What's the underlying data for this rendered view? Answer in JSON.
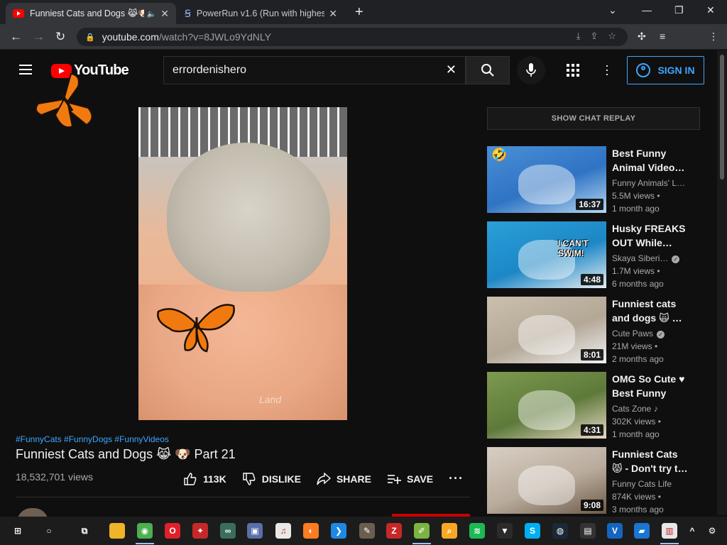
{
  "browser": {
    "tabs": [
      {
        "title": "Funniest Cats and Dogs 😹🐶 P",
        "active": true
      },
      {
        "title": "PowerRun v1.6 (Run with highest",
        "active": false
      }
    ],
    "url_host": "youtube.com",
    "url_path": "/watch?v=8JWLo9YdNLY"
  },
  "youtube": {
    "logo_text": "YouTube",
    "search_value": "errordenishero",
    "sign_in_label": "SIGN IN"
  },
  "video": {
    "watermark": "Land",
    "hashtags": "#FunnyCats #FunnyDogs #FunnyVideos",
    "title": "Funniest Cats and Dogs 😹 🐶 Part 21",
    "views": "18,532,701 views",
    "like_count": "113K",
    "dislike_label": "DISLIKE",
    "share_label": "SHARE",
    "save_label": "SAVE"
  },
  "sidebar": {
    "chat_replay_label": "SHOW CHAT REPLAY",
    "recommendations": [
      {
        "title": "Best Funny Animal Video…",
        "channel": "Funny Animals' L…",
        "verified": false,
        "views": "5.5M views •",
        "age": "1 month ago",
        "duration": "16:37",
        "thumb_text": "",
        "emoji": "🤣",
        "colors": [
          "#4a8fd6",
          "#2f73c4",
          "#b6d6ef"
        ]
      },
      {
        "title": "Husky FREAKS OUT While…",
        "channel": "Skaya Siberi…",
        "verified": true,
        "views": "1.7M views •",
        "age": "6 months ago",
        "duration": "4:48",
        "thumb_text": "I CAN'T SWIM!",
        "emoji": "",
        "colors": [
          "#2a9fd8",
          "#1d87c6",
          "#e9eef2"
        ]
      },
      {
        "title": "Funniest cats and dogs 🙀 …",
        "channel": "Cute Paws",
        "verified": true,
        "views": "21M views •",
        "age": "2 months ago",
        "duration": "8:01",
        "thumb_text": "",
        "emoji": "",
        "colors": [
          "#cbbfae",
          "#b3a796",
          "#f1f1f1"
        ]
      },
      {
        "title": "OMG So Cute ♥ Best Funny Ca…",
        "channel": "Cats Zone ♪",
        "verified": false,
        "views": "302K views •",
        "age": "1 month ago",
        "duration": "4:31",
        "thumb_text": "",
        "emoji": "",
        "colors": [
          "#7c9a4f",
          "#5e7a3a",
          "#e7d8c6"
        ]
      },
      {
        "title": "Funniest Cats 😾 - Don't try t…",
        "channel": "Funny Cats Life",
        "verified": false,
        "views": "874K views •",
        "age": "3 months ago",
        "duration": "9:08",
        "thumb_text": "",
        "emoji": "",
        "colors": [
          "#d8cfc4",
          "#b9ab9c",
          "#6d5a48"
        ]
      }
    ]
  },
  "taskbar": {
    "apps": [
      "windows-start",
      "search",
      "task-view",
      "file-explorer",
      "chrome",
      "opera",
      "unknown-red",
      "network-app",
      "image-app",
      "itunes",
      "firefox",
      "vscode",
      "gimp",
      "filezilla",
      "notepad-plus",
      "search-tool",
      "spotify",
      "wolf-app",
      "skype",
      "steam",
      "film-app",
      "vc-app",
      "app-blue",
      "doc-app",
      "tray-chevron",
      "settings"
    ]
  }
}
